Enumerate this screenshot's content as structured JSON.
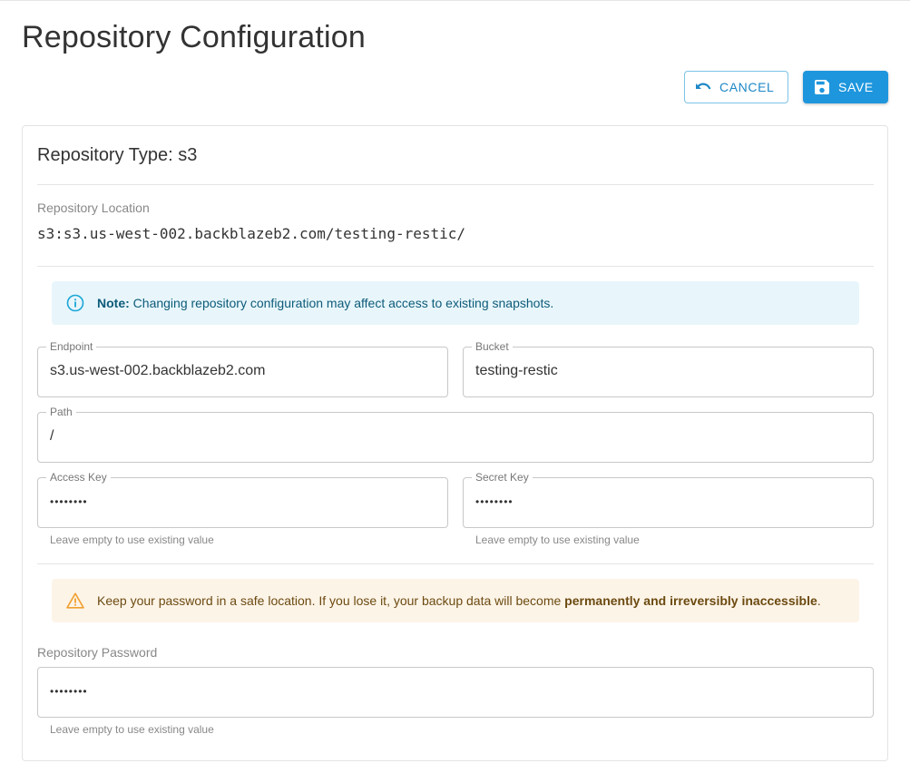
{
  "page": {
    "title": "Repository Configuration"
  },
  "actions": {
    "cancel_label": "CANCEL",
    "save_label": "SAVE"
  },
  "card": {
    "title": "Repository Type: s3",
    "location_label": "Repository Location",
    "location_value": "s3:s3.us-west-002.backblazeb2.com/testing-restic/"
  },
  "info_alert": {
    "icon": "info-icon",
    "bold": "Note:",
    "text": " Changing repository configuration may affect access to existing snapshots."
  },
  "fields": {
    "endpoint": {
      "label": "Endpoint",
      "value": "s3.us-west-002.backblazeb2.com"
    },
    "bucket": {
      "label": "Bucket",
      "value": "testing-restic"
    },
    "path": {
      "label": "Path",
      "value": "/"
    },
    "access_key": {
      "label": "Access Key",
      "value": "••••••••",
      "helper": "Leave empty to use existing value"
    },
    "secret_key": {
      "label": "Secret Key",
      "value": "••••••••",
      "helper": "Leave empty to use existing value"
    }
  },
  "warning_alert": {
    "icon": "warning-icon",
    "text": "Keep your password in a safe location. If you lose it, your backup data will become ",
    "bold": "permanently and irreversibly inaccessible",
    "end": "."
  },
  "password": {
    "label": "Repository Password",
    "value": "••••••••",
    "helper": "Leave empty to use existing value"
  },
  "colors": {
    "primary": "#1e96dd",
    "info_bg": "#e8f6fc",
    "warn_bg": "#fdf4e8",
    "warn_icon": "#f0a030"
  }
}
